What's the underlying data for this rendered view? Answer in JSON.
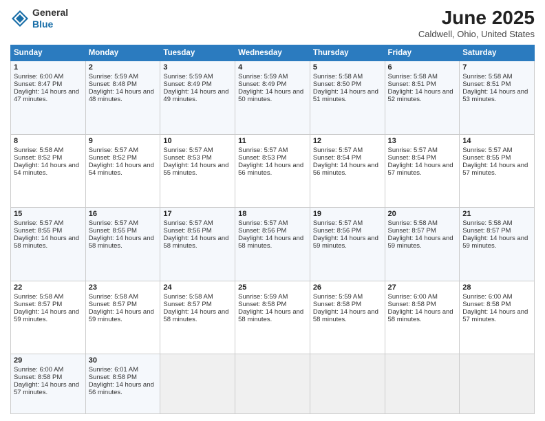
{
  "header": {
    "logo_general": "General",
    "logo_blue": "Blue",
    "month_title": "June 2025",
    "location": "Caldwell, Ohio, United States"
  },
  "days_of_week": [
    "Sunday",
    "Monday",
    "Tuesday",
    "Wednesday",
    "Thursday",
    "Friday",
    "Saturday"
  ],
  "weeks": [
    [
      {
        "day": "1",
        "rise": "Sunrise: 6:00 AM",
        "set": "Sunset: 8:47 PM",
        "daylight": "Daylight: 14 hours and 47 minutes."
      },
      {
        "day": "2",
        "rise": "Sunrise: 5:59 AM",
        "set": "Sunset: 8:48 PM",
        "daylight": "Daylight: 14 hours and 48 minutes."
      },
      {
        "day": "3",
        "rise": "Sunrise: 5:59 AM",
        "set": "Sunset: 8:49 PM",
        "daylight": "Daylight: 14 hours and 49 minutes."
      },
      {
        "day": "4",
        "rise": "Sunrise: 5:59 AM",
        "set": "Sunset: 8:49 PM",
        "daylight": "Daylight: 14 hours and 50 minutes."
      },
      {
        "day": "5",
        "rise": "Sunrise: 5:58 AM",
        "set": "Sunset: 8:50 PM",
        "daylight": "Daylight: 14 hours and 51 minutes."
      },
      {
        "day": "6",
        "rise": "Sunrise: 5:58 AM",
        "set": "Sunset: 8:51 PM",
        "daylight": "Daylight: 14 hours and 52 minutes."
      },
      {
        "day": "7",
        "rise": "Sunrise: 5:58 AM",
        "set": "Sunset: 8:51 PM",
        "daylight": "Daylight: 14 hours and 53 minutes."
      }
    ],
    [
      {
        "day": "8",
        "rise": "Sunrise: 5:58 AM",
        "set": "Sunset: 8:52 PM",
        "daylight": "Daylight: 14 hours and 54 minutes."
      },
      {
        "day": "9",
        "rise": "Sunrise: 5:57 AM",
        "set": "Sunset: 8:52 PM",
        "daylight": "Daylight: 14 hours and 54 minutes."
      },
      {
        "day": "10",
        "rise": "Sunrise: 5:57 AM",
        "set": "Sunset: 8:53 PM",
        "daylight": "Daylight: 14 hours and 55 minutes."
      },
      {
        "day": "11",
        "rise": "Sunrise: 5:57 AM",
        "set": "Sunset: 8:53 PM",
        "daylight": "Daylight: 14 hours and 56 minutes."
      },
      {
        "day": "12",
        "rise": "Sunrise: 5:57 AM",
        "set": "Sunset: 8:54 PM",
        "daylight": "Daylight: 14 hours and 56 minutes."
      },
      {
        "day": "13",
        "rise": "Sunrise: 5:57 AM",
        "set": "Sunset: 8:54 PM",
        "daylight": "Daylight: 14 hours and 57 minutes."
      },
      {
        "day": "14",
        "rise": "Sunrise: 5:57 AM",
        "set": "Sunset: 8:55 PM",
        "daylight": "Daylight: 14 hours and 57 minutes."
      }
    ],
    [
      {
        "day": "15",
        "rise": "Sunrise: 5:57 AM",
        "set": "Sunset: 8:55 PM",
        "daylight": "Daylight: 14 hours and 58 minutes."
      },
      {
        "day": "16",
        "rise": "Sunrise: 5:57 AM",
        "set": "Sunset: 8:55 PM",
        "daylight": "Daylight: 14 hours and 58 minutes."
      },
      {
        "day": "17",
        "rise": "Sunrise: 5:57 AM",
        "set": "Sunset: 8:56 PM",
        "daylight": "Daylight: 14 hours and 58 minutes."
      },
      {
        "day": "18",
        "rise": "Sunrise: 5:57 AM",
        "set": "Sunset: 8:56 PM",
        "daylight": "Daylight: 14 hours and 58 minutes."
      },
      {
        "day": "19",
        "rise": "Sunrise: 5:57 AM",
        "set": "Sunset: 8:56 PM",
        "daylight": "Daylight: 14 hours and 59 minutes."
      },
      {
        "day": "20",
        "rise": "Sunrise: 5:58 AM",
        "set": "Sunset: 8:57 PM",
        "daylight": "Daylight: 14 hours and 59 minutes."
      },
      {
        "day": "21",
        "rise": "Sunrise: 5:58 AM",
        "set": "Sunset: 8:57 PM",
        "daylight": "Daylight: 14 hours and 59 minutes."
      }
    ],
    [
      {
        "day": "22",
        "rise": "Sunrise: 5:58 AM",
        "set": "Sunset: 8:57 PM",
        "daylight": "Daylight: 14 hours and 59 minutes."
      },
      {
        "day": "23",
        "rise": "Sunrise: 5:58 AM",
        "set": "Sunset: 8:57 PM",
        "daylight": "Daylight: 14 hours and 59 minutes."
      },
      {
        "day": "24",
        "rise": "Sunrise: 5:58 AM",
        "set": "Sunset: 8:57 PM",
        "daylight": "Daylight: 14 hours and 58 minutes."
      },
      {
        "day": "25",
        "rise": "Sunrise: 5:59 AM",
        "set": "Sunset: 8:58 PM",
        "daylight": "Daylight: 14 hours and 58 minutes."
      },
      {
        "day": "26",
        "rise": "Sunrise: 5:59 AM",
        "set": "Sunset: 8:58 PM",
        "daylight": "Daylight: 14 hours and 58 minutes."
      },
      {
        "day": "27",
        "rise": "Sunrise: 6:00 AM",
        "set": "Sunset: 8:58 PM",
        "daylight": "Daylight: 14 hours and 58 minutes."
      },
      {
        "day": "28",
        "rise": "Sunrise: 6:00 AM",
        "set": "Sunset: 8:58 PM",
        "daylight": "Daylight: 14 hours and 57 minutes."
      }
    ],
    [
      {
        "day": "29",
        "rise": "Sunrise: 6:00 AM",
        "set": "Sunset: 8:58 PM",
        "daylight": "Daylight: 14 hours and 57 minutes."
      },
      {
        "day": "30",
        "rise": "Sunrise: 6:01 AM",
        "set": "Sunset: 8:58 PM",
        "daylight": "Daylight: 14 hours and 56 minutes."
      },
      null,
      null,
      null,
      null,
      null
    ]
  ]
}
